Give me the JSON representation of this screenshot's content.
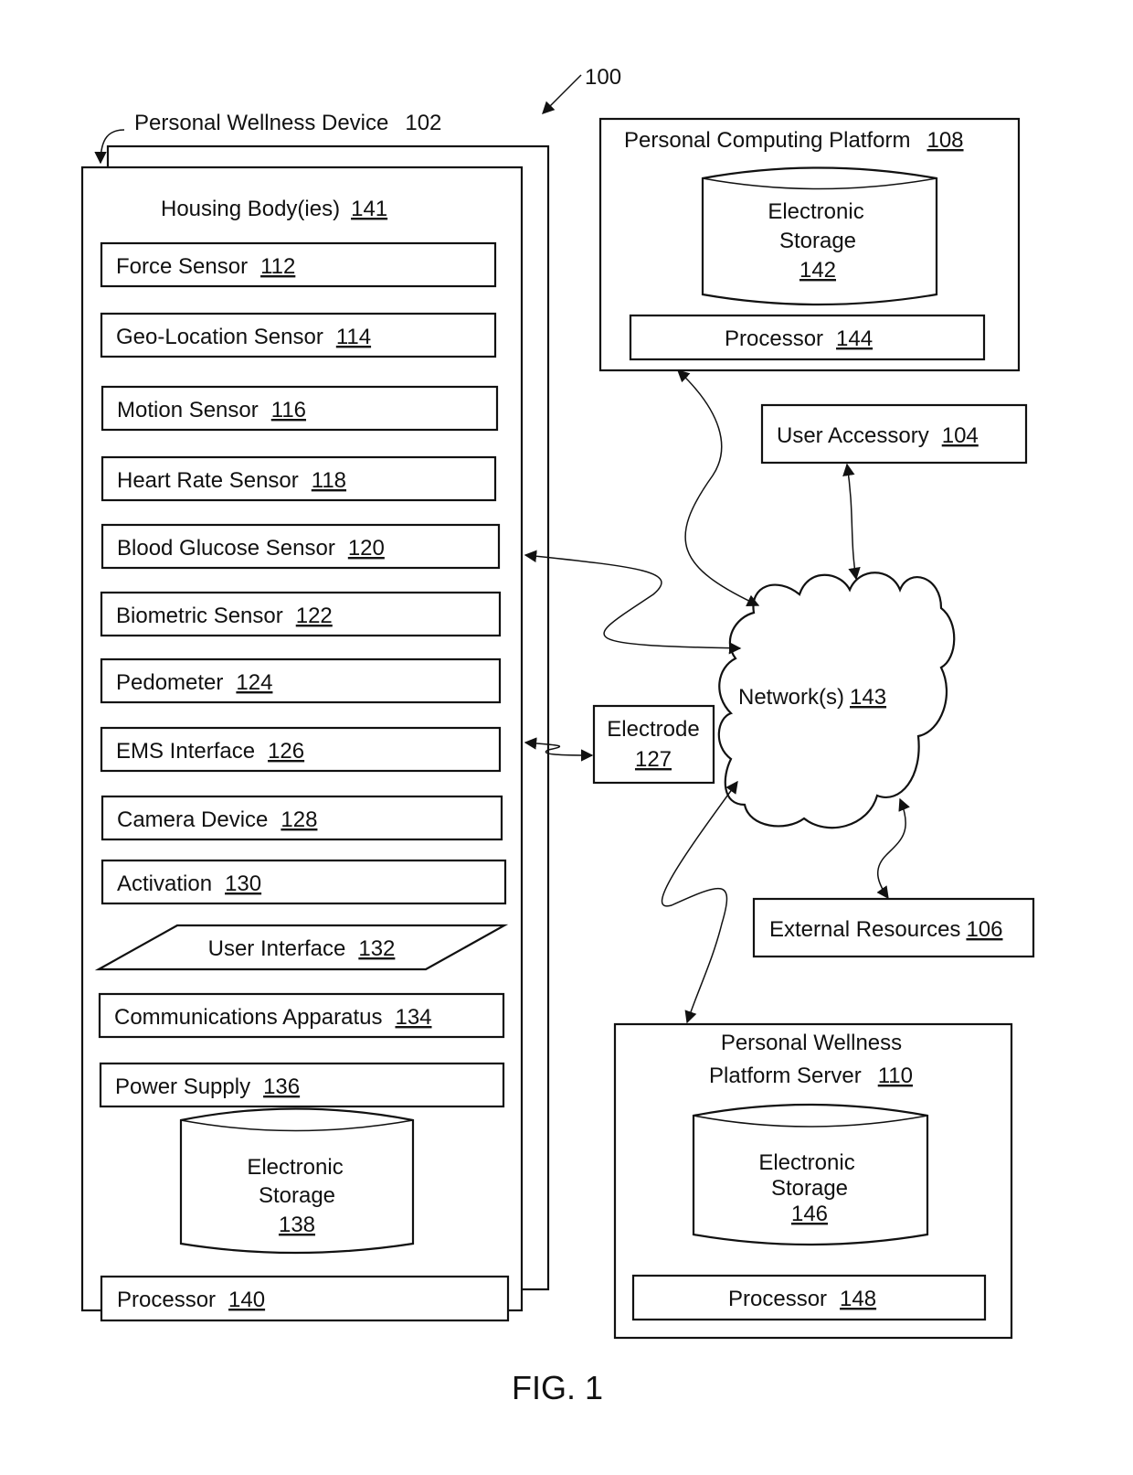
{
  "figure": {
    "ref": "100",
    "caption": "FIG. 1"
  },
  "device": {
    "title": "Personal Wellness Device",
    "ref": "102",
    "housing": {
      "label": "Housing Body(ies)",
      "ref": "141"
    },
    "components": [
      {
        "label": "Force Sensor",
        "ref": "112"
      },
      {
        "label": "Geo-Location Sensor",
        "ref": "114"
      },
      {
        "label": "Motion Sensor",
        "ref": "116"
      },
      {
        "label": "Heart Rate Sensor",
        "ref": "118"
      },
      {
        "label": "Blood Glucose Sensor",
        "ref": "120"
      },
      {
        "label": "Biometric Sensor",
        "ref": "122"
      },
      {
        "label": "Pedometer",
        "ref": "124"
      },
      {
        "label": "EMS Interface",
        "ref": "126"
      },
      {
        "label": "Camera Device",
        "ref": "128"
      },
      {
        "label": "Activation",
        "ref": "130"
      },
      {
        "label": "User Interface",
        "ref": "132"
      },
      {
        "label": "Communications Apparatus",
        "ref": "134"
      },
      {
        "label": "Power Supply",
        "ref": "136"
      }
    ],
    "storage": {
      "line1": "Electronic",
      "line2": "Storage",
      "ref": "138"
    },
    "processor": {
      "label": "Processor",
      "ref": "140"
    }
  },
  "computing_platform": {
    "title": "Personal Computing Platform",
    "ref": "108",
    "storage": {
      "line1": "Electronic",
      "line2": "Storage",
      "ref": "142"
    },
    "processor": {
      "label": "Processor",
      "ref": "144"
    }
  },
  "user_accessory": {
    "label": "User Accessory",
    "ref": "104"
  },
  "network": {
    "label": "Network(s)",
    "ref": "143"
  },
  "electrode": {
    "label": "Electrode",
    "ref": "127"
  },
  "external_resources": {
    "label": "External Resources",
    "ref": "106"
  },
  "server": {
    "line1": "Personal Wellness",
    "line2": "Platform Server",
    "ref": "110",
    "storage": {
      "line1": "Electronic",
      "line2": "Storage",
      "ref": "146"
    },
    "processor": {
      "label": "Processor",
      "ref": "148"
    }
  }
}
